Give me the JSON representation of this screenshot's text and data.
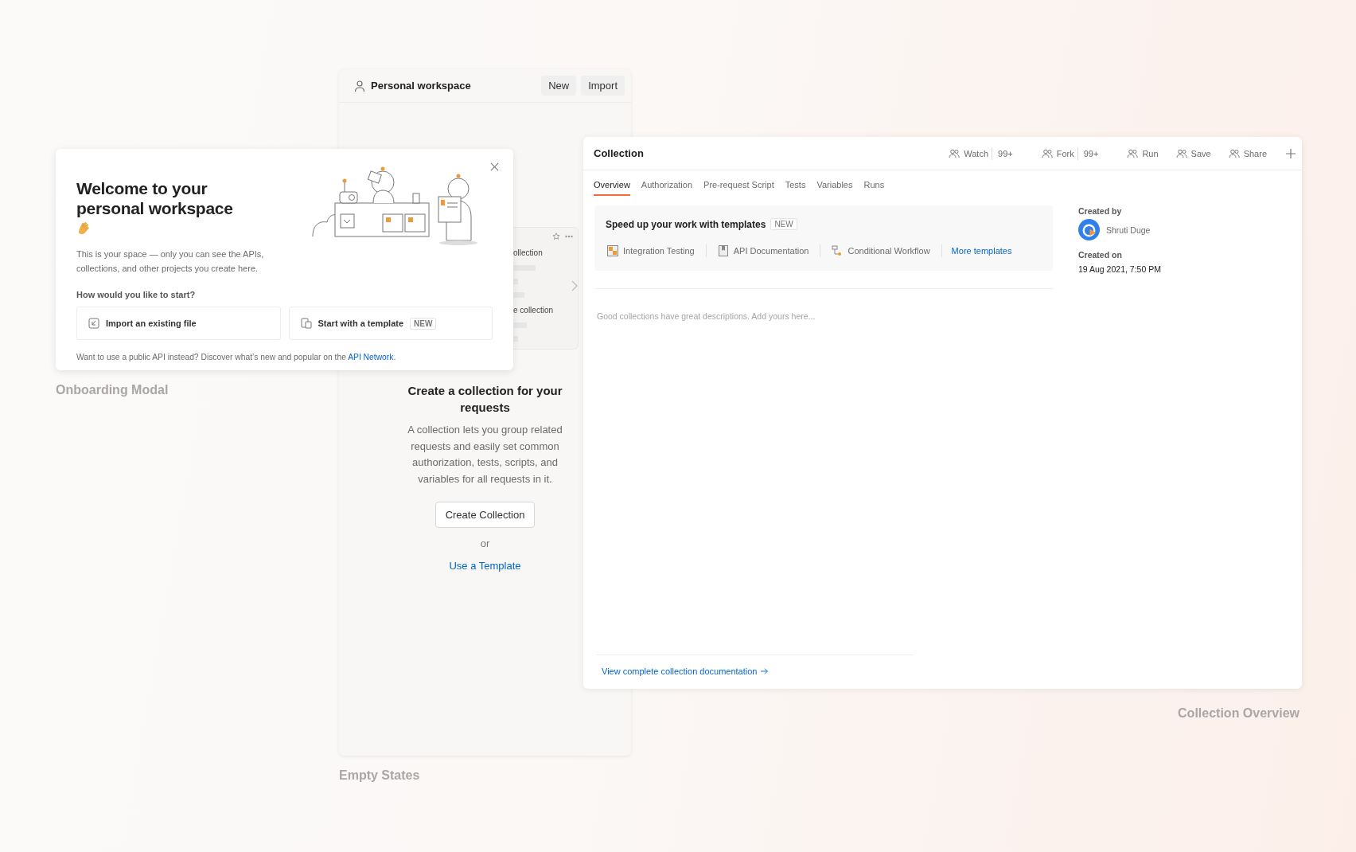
{
  "modal": {
    "title": "Welcome to your personal workspace",
    "description": "This is your space — only you can see the APIs, collections, and other projects you create here.",
    "prompt": "How would you like to start?",
    "options": [
      {
        "kind": "import",
        "label": "Import an existing file"
      },
      {
        "kind": "template",
        "label": "Start with a template",
        "badge": "NEW"
      }
    ],
    "footer_text": "Want to use a public API instead? Discover what’s new and popular on the",
    "footer_link": "API Network",
    "footer_end": ".",
    "caption": "Onboarding Modal"
  },
  "workspace": {
    "title": "Personal workspace",
    "buttons": [
      "New",
      "Import"
    ],
    "preview_texts": [
      "ollection",
      "e collection"
    ],
    "heading": "Create a collection for your requests",
    "description": "A collection lets you group related requests and easily set common authorization, tests, scripts, and variables for all requests in it.",
    "primary_button": "Create Collection",
    "separator": "or",
    "link": "Use a Template",
    "caption": "Empty States"
  },
  "collection": {
    "title": "Collection",
    "actions": [
      {
        "label": "Watch",
        "count": "99+"
      },
      {
        "label": "Fork",
        "count": "99+"
      },
      {
        "label": "Run"
      },
      {
        "label": "Save"
      },
      {
        "label": "Share"
      }
    ],
    "tabs": [
      {
        "label": "Overview",
        "selected": true
      },
      {
        "label": "Authorization",
        "selected": false
      },
      {
        "label": "Pre-request Script",
        "selected": false
      },
      {
        "label": "Tests",
        "selected": false
      },
      {
        "label": "Variables",
        "selected": false
      },
      {
        "label": "Runs",
        "selected": false
      }
    ],
    "templates": {
      "title": "Speed up your work with templates",
      "badge": "NEW",
      "items": [
        {
          "kind": "testing",
          "label": "Integration Testing"
        },
        {
          "kind": "docs",
          "label": "API Documentation"
        },
        {
          "kind": "workflow",
          "label": "Conditional Workflow"
        }
      ],
      "more": "More templates"
    },
    "created_by_label": "Created by",
    "author": "Shruti Duge",
    "created_on_label": "Created on",
    "created_on": "19 Aug 2021, 7:50 PM",
    "description_placeholder": "Good collections have great descriptions. Add yours here...",
    "docs_link": "View complete collection documentation",
    "caption": "Collection Overview"
  }
}
